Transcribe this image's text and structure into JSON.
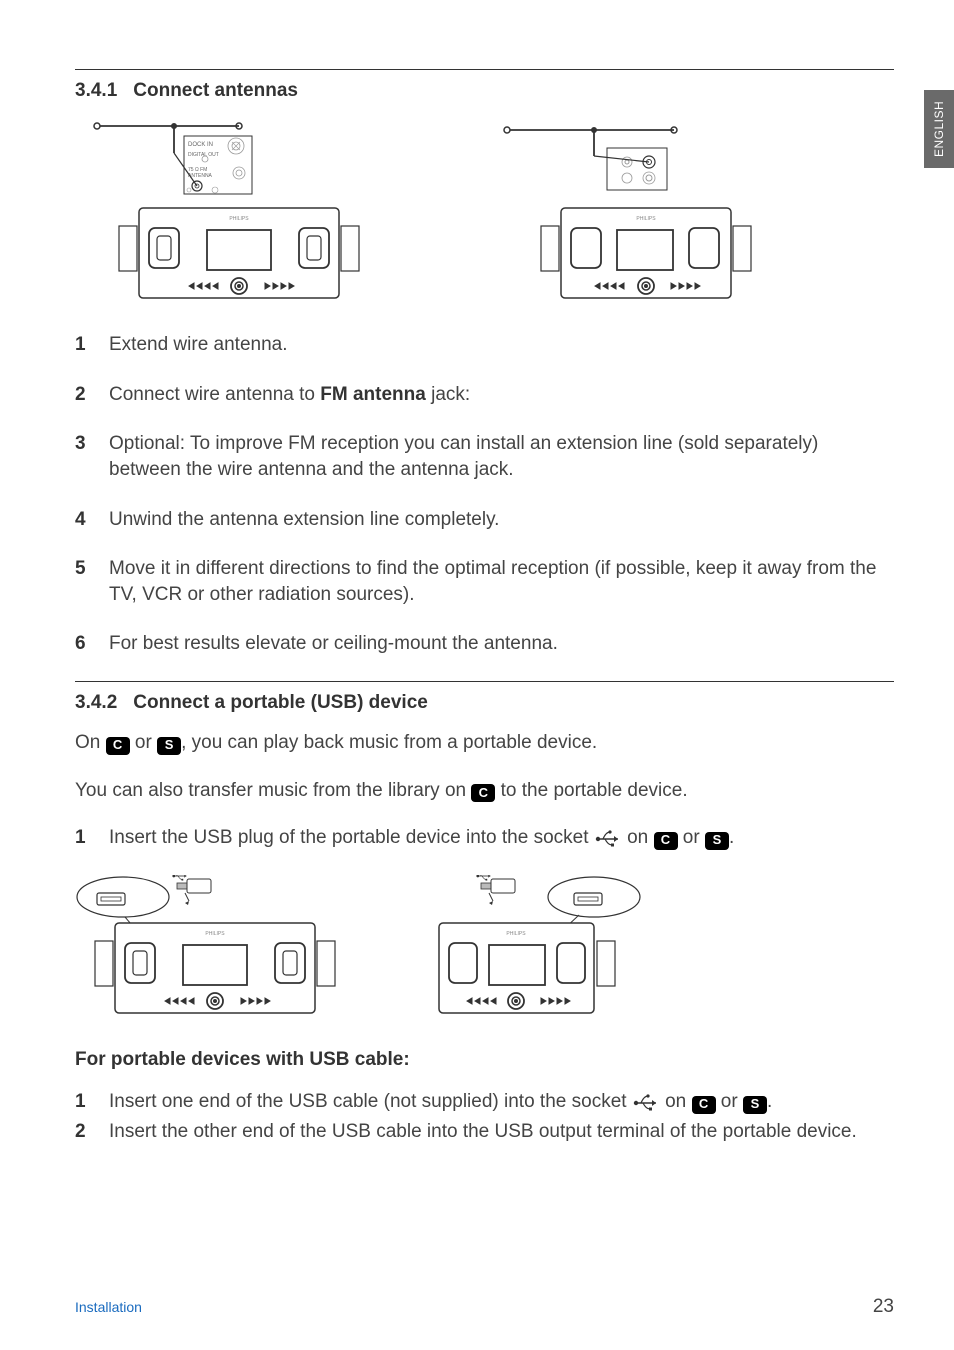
{
  "sidebar": {
    "language": "ENGLISH"
  },
  "section1": {
    "number": "3.4.1",
    "title": "Connect antennas",
    "diagram": {
      "labels": {
        "dock_in": "DOCK IN",
        "digital_out": "DIGITAL OUT",
        "fm_antenna": "75 Ω FM ANTENNA",
        "brand": "PHILIPS"
      }
    },
    "steps": [
      {
        "n": "1",
        "text": "Extend wire antenna."
      },
      {
        "n": "2",
        "text_before": "Connect wire antenna to ",
        "bold": "FM antenna",
        "text_after": " jack:"
      },
      {
        "n": "3",
        "text": "Optional: To improve FM reception you can install an extension line (sold separately) between the wire antenna and the antenna jack."
      },
      {
        "n": "4",
        "text": "Unwind the antenna extension line completely."
      },
      {
        "n": "5",
        "text": "Move it in different directions to find the optimal reception (if possible, keep it away from the TV,  VCR or other radiation sources)."
      },
      {
        "n": "6",
        "text": "For best results elevate or ceiling-mount the antenna."
      }
    ]
  },
  "section2": {
    "number": "3.4.2",
    "title": "Connect a portable (USB) device",
    "intro1": {
      "p1": "On ",
      "badge1": "C",
      "p2": " or ",
      "badge2": "S",
      "p3": ", you can play back music from a portable device."
    },
    "intro2": {
      "p1": "You can also transfer music from the library on ",
      "badge1": "C",
      "p2": " to the portable device."
    },
    "step1": {
      "n": "1",
      "p1": "Insert the USB plug of the portable device into the socket ",
      "p2": " on ",
      "badge1": "C",
      "p3": " or ",
      "badge2": "S",
      "p4": "."
    },
    "subhead": "For portable devices with USB cable:",
    "cable_steps": [
      {
        "n": "1",
        "p1": "Insert one end of the USB cable (not supplied) into the socket ",
        "p2": " on ",
        "badge1": "C",
        "p3": " or ",
        "badge2": "S",
        "p4": "."
      },
      {
        "n": "2",
        "text": "Insert the other end of the USB cable into the USB output terminal of the portable device."
      }
    ]
  },
  "footer": {
    "section_name": "Installation",
    "page_number": "23"
  }
}
